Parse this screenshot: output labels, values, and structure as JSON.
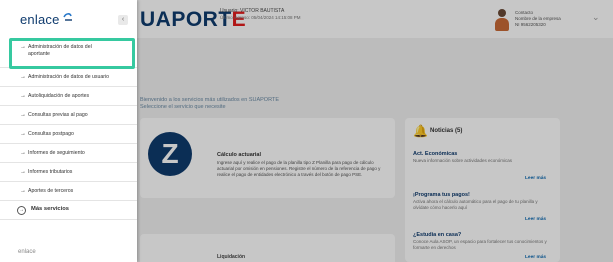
{
  "app": {
    "brand_left": "UAPORT",
    "brand_right": "E",
    "user_line1": "Usuario: VICTOR BAUTISTA",
    "user_line2": "Último ingreso: 05/04/2024 14:15:08 PM",
    "profile_line1": "Contacto",
    "profile_line2": "Nombre de la empresa",
    "profile_line3": "NI 9562205320",
    "welcome_line1": "Bienvenido a los servicios más utilizados en SUAPORTE",
    "welcome_line2": "Seleccione el servicio que necesite",
    "main_card": {
      "title": "Cálculo actuarial",
      "text": "Ingrese aquí y realice el pago de la planilla tipo Z Planilla para pago de cálculo actuarial por omisión en pensiones. Registre el número de la referencia de pago y realice el pago de entidades electrónico a través del botón de pago PSE."
    },
    "notifications": {
      "title": "Noticias (5)",
      "items": [
        {
          "title": "Act. Económicas",
          "text": "Nueva información sobre actividades económicas",
          "link": "Leer más"
        },
        {
          "title": "¡Programa tus pagos!",
          "text": "Activa ahora el cálculo automático para el pago de tu planilla y olvídate cómo hacerlo aquí",
          "link": "Leer más"
        },
        {
          "title": "¿Estudia en casa?",
          "text": "Conoce Aula ASOP, un espacio para fortalecer tus conocimientos y formarte en derechos",
          "link": "Leer más"
        }
      ]
    },
    "lower_card_text": "Liquidación"
  },
  "sidebar": {
    "logo_text": "enlace",
    "collapse_icon": "chevron-left-icon",
    "highlight_color": "#36c9a0",
    "items": [
      {
        "label": "Administración de datos del aportante"
      },
      {
        "label": "Administración de datos de usuario"
      },
      {
        "label": "Autoliquidación de aportes"
      },
      {
        "label": "Consultas previas al pago"
      },
      {
        "label": "Consultas postpago"
      },
      {
        "label": "Informes de seguimiento"
      },
      {
        "label": "Informes tributarios"
      },
      {
        "label": "Aportes de terceros"
      }
    ],
    "more": {
      "label": "Más servicios"
    },
    "bottom_text": "enlace"
  }
}
